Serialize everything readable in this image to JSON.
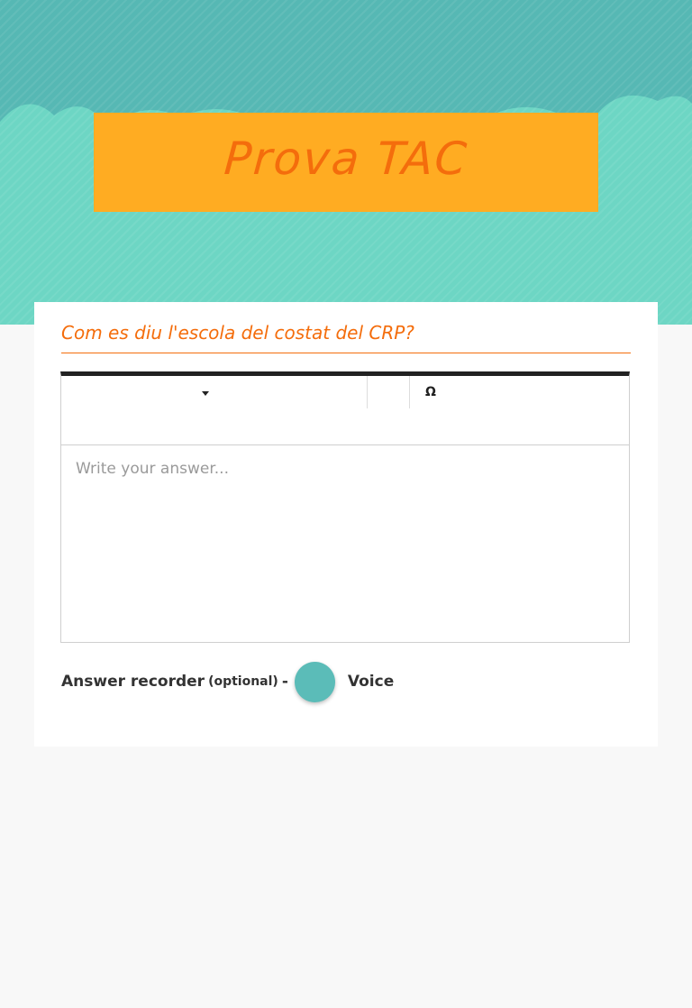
{
  "header": {
    "title": "Prova TAC"
  },
  "question": {
    "text": "Com es diu l'escola del costat del CRP?"
  },
  "editor": {
    "special_char_icon": "Ω",
    "answer_placeholder": "Write your answer..."
  },
  "recorder": {
    "label": "Answer recorder",
    "optional": "(optional)",
    "separator": "-",
    "voice_label": "Voice"
  },
  "colors": {
    "hero_background": "#56b8b4",
    "clouds": "#6dd6c4",
    "title_box": "#ffac22",
    "title_text": "#f46d0c",
    "toggle": "#5bbcb8",
    "page_background": "#f8f8f8"
  }
}
